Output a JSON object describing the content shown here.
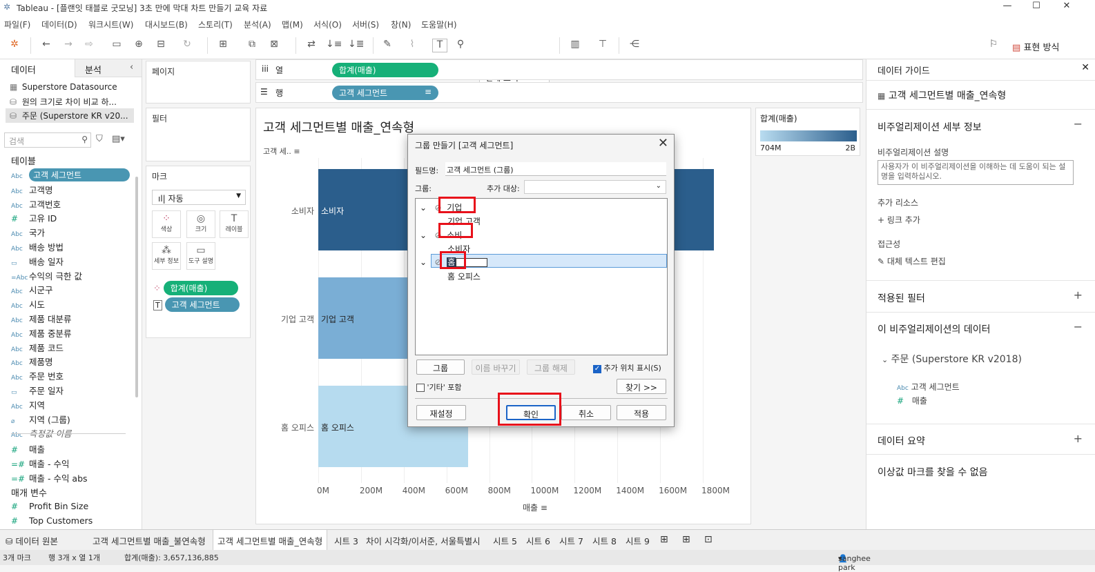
{
  "window": {
    "title": "Tableau - [플랜잇 태블로 굿모닝] 3초 만에 막대 차트 만들기 교육 자료",
    "minimize": "—",
    "maximize": "☐",
    "close": "✕"
  },
  "menu": [
    "파일(F)",
    "데이터(D)",
    "워크시트(W)",
    "대시보드(B)",
    "스토리(T)",
    "분석(A)",
    "맵(M)",
    "서식(O)",
    "서버(S)",
    "창(N)",
    "도움말(H)"
  ],
  "toolbar": {
    "view_dropdown": "전체 보기",
    "show_me": "표현 방식"
  },
  "left_panel": {
    "tab_data": "데이터",
    "tab_analysis": "분석",
    "datasources": [
      "Superstore Datasource",
      "원의 크기로 차이 비교 하...",
      "주문 (Superstore KR v20..."
    ],
    "search_placeholder": "검색",
    "tables_label": "테이블",
    "fields": [
      {
        "type": "Abc",
        "name": "고객 세그먼트",
        "highlight": true
      },
      {
        "type": "Abc",
        "name": "고객명"
      },
      {
        "type": "Abc",
        "name": "고객번호"
      },
      {
        "type": "#",
        "name": "고유 ID"
      },
      {
        "type": "Abc",
        "name": "국가"
      },
      {
        "type": "Abc",
        "name": "배송 방법"
      },
      {
        "type": "date",
        "name": "배송 일자"
      },
      {
        "type": "=Abc",
        "name": "수익의 극한 값"
      },
      {
        "type": "Abc",
        "name": "시군구"
      },
      {
        "type": "Abc",
        "name": "시도"
      },
      {
        "type": "Abc",
        "name": "제품 대분류"
      },
      {
        "type": "Abc",
        "name": "제품 중분류"
      },
      {
        "type": "Abc",
        "name": "제품 코드"
      },
      {
        "type": "Abc",
        "name": "제품명"
      },
      {
        "type": "Abc",
        "name": "주문 번호"
      },
      {
        "type": "date",
        "name": "주문 일자"
      },
      {
        "type": "Abc",
        "name": "지역"
      },
      {
        "type": "clip",
        "name": "지역 (그룹)"
      },
      {
        "type": "Abc",
        "name": "측정값 이름",
        "italic": true
      }
    ],
    "measures": [
      {
        "type": "#",
        "name": "매출"
      },
      {
        "type": "=#",
        "name": "매출 - 수익"
      },
      {
        "type": "=#",
        "name": "매출 - 수익 abs"
      }
    ],
    "params_label": "매개 변수",
    "params": [
      {
        "type": "#",
        "name": "Profit Bin Size"
      },
      {
        "type": "#",
        "name": "Top Customers"
      }
    ]
  },
  "cards": {
    "pages": "페이지",
    "filters": "필터",
    "marks": "마크",
    "mark_type": "자동",
    "mark_buttons": [
      "색상",
      "크기",
      "레이블",
      "세부 정보",
      "도구 설명"
    ],
    "mark_pills": [
      "합계(매출)",
      "고객 세그먼트"
    ]
  },
  "shelves": {
    "columns_label": "열",
    "rows_label": "행",
    "columns_pill": "합계(매출)",
    "rows_pill": "고객 세그먼트"
  },
  "view": {
    "title": "고객 세그먼트별 매출_연속형",
    "row_header": "고객 세..",
    "x_axis_title": "매출"
  },
  "chart_data": {
    "type": "bar",
    "orientation": "horizontal",
    "title": "고객 세그먼트별 매출_연속형",
    "categories": [
      "소비자",
      "기업 고객",
      "홈 오피스"
    ],
    "values": [
      1850,
      1100,
      700
    ],
    "bar_colors": [
      "#2b5e8c",
      "#7aaed5",
      "#b6dbef"
    ],
    "xlabel": "매출",
    "ylabel": "고객 세..",
    "xlim": [
      0,
      1900
    ],
    "x_ticks": [
      "0M",
      "200M",
      "400M",
      "600M",
      "800M",
      "1000M",
      "1200M",
      "1400M",
      "1600M",
      "1800M"
    ],
    "grid": true
  },
  "legend": {
    "title": "합계(매출)",
    "min": "704M",
    "max": "2B"
  },
  "right_panel": {
    "header": "데이터 가이드",
    "sheet_name": "고객 세그먼트별 매출_연속형",
    "viz_details": "비주얼리제이션 세부 정보",
    "viz_desc_label": "비주얼리제이션 설명",
    "viz_desc_placeholder": "사용자가 이 비주얼리제이션을 이해하는 데 도움이 되는 설명을 입력하십시오.",
    "resources_label": "추가 리소스",
    "add_link": "링크 추가",
    "accessibility_label": "접근성",
    "alt_text": "대체 텍스트 편집",
    "applied_filters": "적용된 필터",
    "viz_data": "이 비주얼리제이션의 데이터",
    "datasource": "주문 (Superstore KR v2018)",
    "data_fields": [
      {
        "type": "Abc",
        "name": "고객 세그먼트"
      },
      {
        "type": "#",
        "name": "매출"
      }
    ],
    "data_summary": "데이터 요약",
    "outliers": "이상값 마크를 찾을 수 없음"
  },
  "dialog": {
    "title": "그룹 만들기 [고객 세그먼트]",
    "field_name_label": "필드명:",
    "field_name_value": "고객 세그먼트 (그룹)",
    "group_label": "그룹:",
    "add_to_label": "추가 대상:",
    "tree": [
      {
        "group": "기업",
        "members": [
          "기업 고객"
        ]
      },
      {
        "group": "소비",
        "members": [
          "소비자"
        ]
      },
      {
        "group": "홈",
        "members": [
          "홈 오피스"
        ]
      }
    ],
    "btn_group": "그룹",
    "btn_rename": "이름 바꾸기",
    "btn_ungroup": "그룹 해제",
    "show_added_label": "추가 위치 표시(S)",
    "include_other_label": "'기타' 포함",
    "find_btn": "찾기 >>",
    "reset_btn": "재설정",
    "ok_btn": "확인",
    "cancel_btn": "취소",
    "apply_btn": "적용"
  },
  "sheet_tabs": [
    "데이터 원본",
    "고객 세그먼트별 매출_불연속형",
    "고객 세그먼트별 매출_연속형",
    "시트 3",
    "차이 시각화/이서준, 서울특별시",
    "시트 5",
    "시트 6",
    "시트 7",
    "시트 8",
    "시트 9"
  ],
  "status": {
    "marks": "3개 마크",
    "rows_cols": "행 3개 x 열 1개",
    "sum": "합계(매출): 3,657,136,885",
    "user": "sanghee park"
  }
}
